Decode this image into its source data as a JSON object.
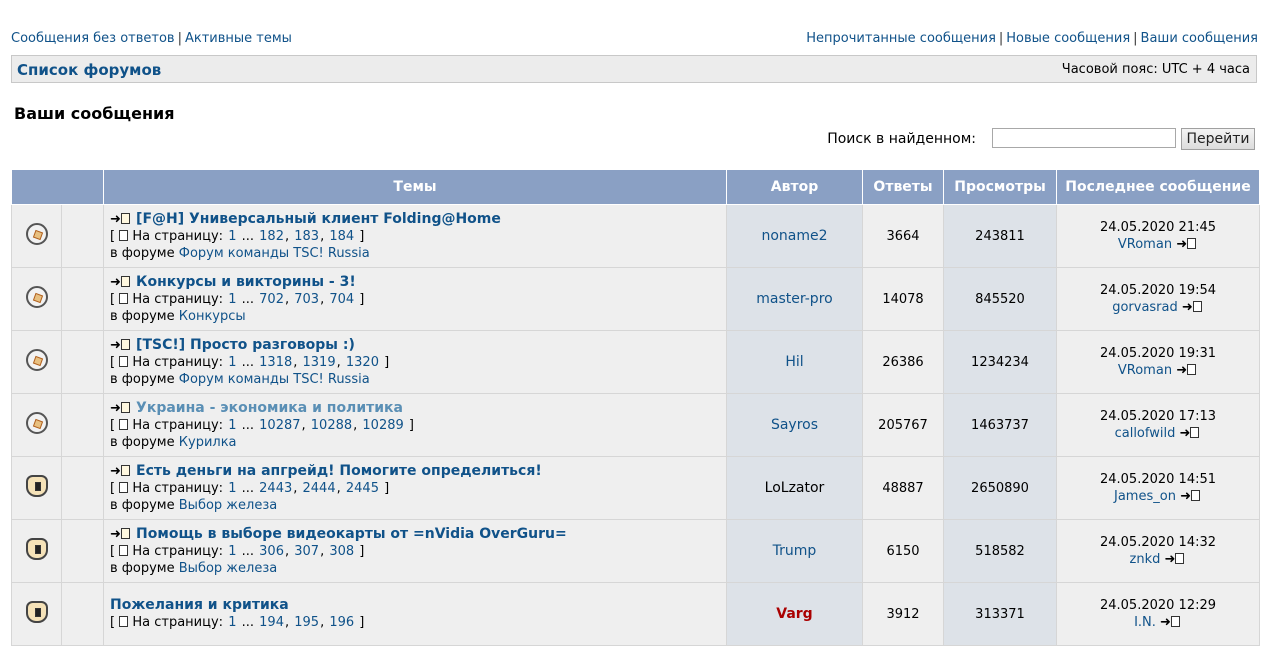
{
  "topnav": {
    "left": [
      "Сообщения без ответов",
      "Активные темы"
    ],
    "right": [
      "Непрочитанные сообщения",
      "Новые сообщения",
      "Ваши сообщения"
    ]
  },
  "navbar": {
    "forum_list": "Список форумов",
    "timezone": "Часовой пояс: UTC + 4 часа"
  },
  "page_title": "Ваши сообщения",
  "search": {
    "label": "Поиск в найденном:",
    "value": "",
    "button": "Перейти"
  },
  "table": {
    "headers": [
      "Темы",
      "Автор",
      "Ответы",
      "Просмотры",
      "Последнее сообщение"
    ],
    "pages_label": "На страницу:",
    "in_forum_label": "в форуме",
    "rows": [
      {
        "icon": "read-topic-icon",
        "title": "[F@H] Универсальный клиент Folding@Home",
        "pages": [
          "1",
          "...",
          "182",
          "183",
          "184"
        ],
        "forum": "Форум команды TSC! Russia",
        "author": "noname2",
        "replies": "3664",
        "views": "243811",
        "last_date": "24.05.2020 21:45",
        "last_user": "VRoman"
      },
      {
        "icon": "read-topic-icon",
        "title": "Конкурсы и викторины - 3!",
        "pages": [
          "1",
          "...",
          "702",
          "703",
          "704"
        ],
        "forum": "Конкурсы",
        "author": "master-pro",
        "replies": "14078",
        "views": "845520",
        "last_date": "24.05.2020 19:54",
        "last_user": "gorvasrad"
      },
      {
        "icon": "read-topic-icon",
        "title": "[TSC!] Просто разговоры :)",
        "pages": [
          "1",
          "...",
          "1318",
          "1319",
          "1320"
        ],
        "forum": "Форум команды TSC! Russia",
        "author": "Hil",
        "replies": "26386",
        "views": "1234234",
        "last_date": "24.05.2020 19:31",
        "last_user": "VRoman"
      },
      {
        "icon": "read-topic-icon",
        "title": "Украина - экономика и политика",
        "pages": [
          "1",
          "...",
          "10287",
          "10288",
          "10289"
        ],
        "forum": "Курилка",
        "author": "Sayros",
        "replies": "205767",
        "views": "1463737",
        "last_date": "24.05.2020 17:13",
        "last_user": "callofwild"
      },
      {
        "icon": "hot-topic-icon",
        "title": "Есть деньги на апгрейд! Помогите определиться!",
        "pages": [
          "1",
          "...",
          "2443",
          "2444",
          "2445"
        ],
        "forum": "Выбор железа",
        "author": "LoLzator",
        "replies": "48887",
        "views": "2650890",
        "last_date": "24.05.2020 14:51",
        "last_user": "James_on"
      },
      {
        "icon": "hot-topic-icon",
        "title": "Помощь в выборе видеокарты от =nVidia OverGuru=",
        "pages": [
          "1",
          "...",
          "306",
          "307",
          "308"
        ],
        "forum": "Выбор железа",
        "author": "Trump",
        "replies": "6150",
        "views": "518582",
        "last_date": "24.05.2020 14:32",
        "last_user": "znkd"
      },
      {
        "icon": "hot-topic-icon",
        "title": "Пожелания и критика",
        "pages": [
          "1",
          "...",
          "194",
          "195",
          "196"
        ],
        "forum": "",
        "author": "Varg",
        "replies": "3912",
        "views": "313371",
        "last_date": "24.05.2020 12:29",
        "last_user": "I.N."
      }
    ]
  }
}
